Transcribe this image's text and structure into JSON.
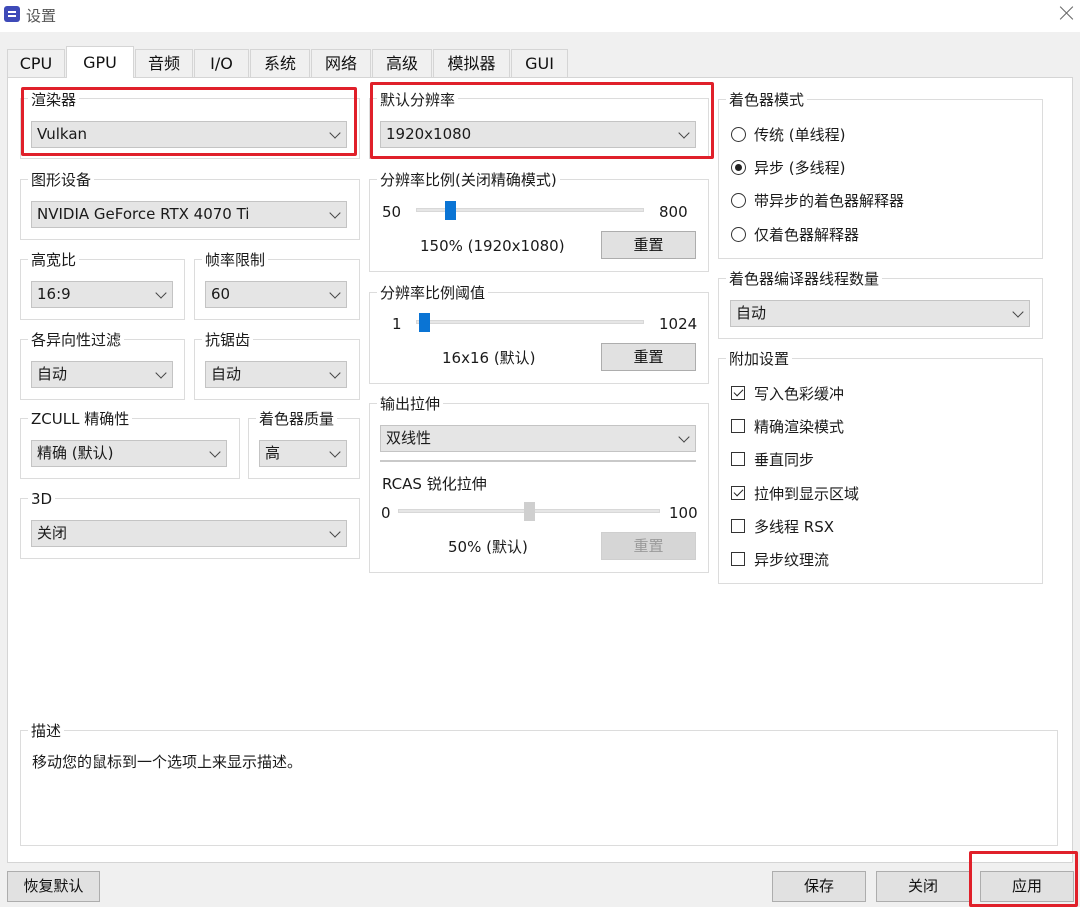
{
  "window": {
    "title": "设置",
    "icon": "app-logo-icon",
    "close_icon": "close-icon"
  },
  "tabs": [
    {
      "label": "CPU",
      "active": false
    },
    {
      "label": "GPU",
      "active": true
    },
    {
      "label": "音频",
      "active": false
    },
    {
      "label": "I/O",
      "active": false
    },
    {
      "label": "系统",
      "active": false
    },
    {
      "label": "网络",
      "active": false
    },
    {
      "label": "高级",
      "active": false
    },
    {
      "label": "模拟器",
      "active": false
    },
    {
      "label": "GUI",
      "active": false
    }
  ],
  "left": {
    "renderer": {
      "label": "渲染器",
      "value": "Vulkan"
    },
    "graphics_device": {
      "label": "图形设备",
      "value": "NVIDIA GeForce RTX 4070 Ti"
    },
    "aspect_ratio": {
      "label": "高宽比",
      "value": "16:9"
    },
    "framerate_limit": {
      "label": "帧率限制",
      "value": "60"
    },
    "anisotropic_filter": {
      "label": "各异向性过滤",
      "value": "自动"
    },
    "anti_aliasing": {
      "label": "抗锯齿",
      "value": "自动"
    },
    "zcull": {
      "label": "ZCULL 精确性",
      "value": "精确 (默认)"
    },
    "shader_quality": {
      "label": "着色器质量",
      "value": "高"
    },
    "three_d": {
      "label": "3D",
      "value": "关闭"
    }
  },
  "middle": {
    "default_resolution": {
      "label": "默认分辨率",
      "value": "1920x1080"
    },
    "resolution_scale": {
      "label": "分辨率比例(关闭精确模式)",
      "min": "50",
      "max": "800",
      "value_text": "150% (1920x1080)",
      "level_percent": 150,
      "reset": "重置"
    },
    "scale_threshold": {
      "label": "分辨率比例阈值",
      "min": "1",
      "max": "1024",
      "value_text": "16x16 (默认)",
      "reset": "重置"
    },
    "output_scaling": {
      "label": "输出拉伸",
      "value": "双线性"
    },
    "rcas": {
      "label": "RCAS 锐化拉伸",
      "min": "0",
      "max": "100",
      "value_text": "50% (默认)",
      "level_percent": 50,
      "reset": "重置"
    }
  },
  "right": {
    "shader_mode": {
      "label": "着色器模式",
      "options": [
        {
          "label": "传统 (单线程)",
          "selected": false
        },
        {
          "label": "异步 (多线程)",
          "selected": true
        },
        {
          "label": "带异步的着色器解释器",
          "selected": false
        },
        {
          "label": "仅着色器解释器",
          "selected": false
        }
      ]
    },
    "compiler_threads": {
      "label": "着色器编译器线程数量",
      "value": "自动"
    },
    "additional": {
      "label": "附加设置",
      "options": [
        {
          "label": "写入色彩缓冲",
          "checked": true
        },
        {
          "label": "精确渲染模式",
          "checked": false
        },
        {
          "label": "垂直同步",
          "checked": false
        },
        {
          "label": "拉伸到显示区域",
          "checked": true
        },
        {
          "label": "多线程 RSX",
          "checked": false
        },
        {
          "label": "异步纹理流",
          "checked": false
        }
      ]
    }
  },
  "description": {
    "label": "描述",
    "text": "移动您的鼠标到一个选项上来显示描述。"
  },
  "footer": {
    "restore_defaults": "恢复默认",
    "save": "保存",
    "close": "关闭",
    "apply": "应用"
  },
  "colors": {
    "annotation": "#e0202a",
    "slider_thumb": "#0a74d4"
  }
}
